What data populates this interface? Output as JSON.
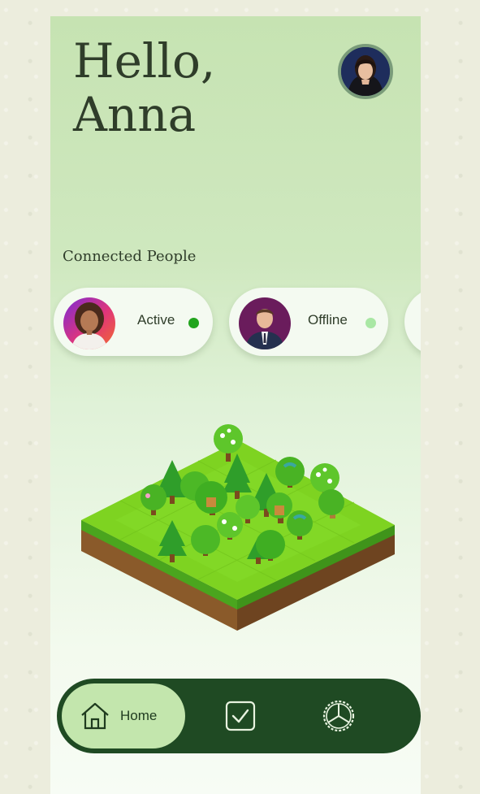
{
  "header": {
    "greeting_line1": "Hello,",
    "greeting_line2": "Anna"
  },
  "profile": {
    "avatar_icon": "profile-avatar-icon"
  },
  "connected": {
    "title": "Connected People",
    "people": [
      {
        "status": "Active",
        "status_color": "#22a41e",
        "avatar_icon": "woman-avatar-icon"
      },
      {
        "status": "Offline",
        "status_color": "#a9e7a4",
        "avatar_icon": "man-avatar-icon"
      }
    ]
  },
  "nav": {
    "home_label": "Home",
    "home_icon": "home-icon",
    "tasks_icon": "checkbox-icon",
    "settings_icon": "steering-wheel-icon"
  },
  "colors": {
    "nav_bg": "#1f4a23",
    "nav_active_bg": "#c3e6ad",
    "active_dot": "#22a41e",
    "offline_dot": "#a9e7a4"
  }
}
